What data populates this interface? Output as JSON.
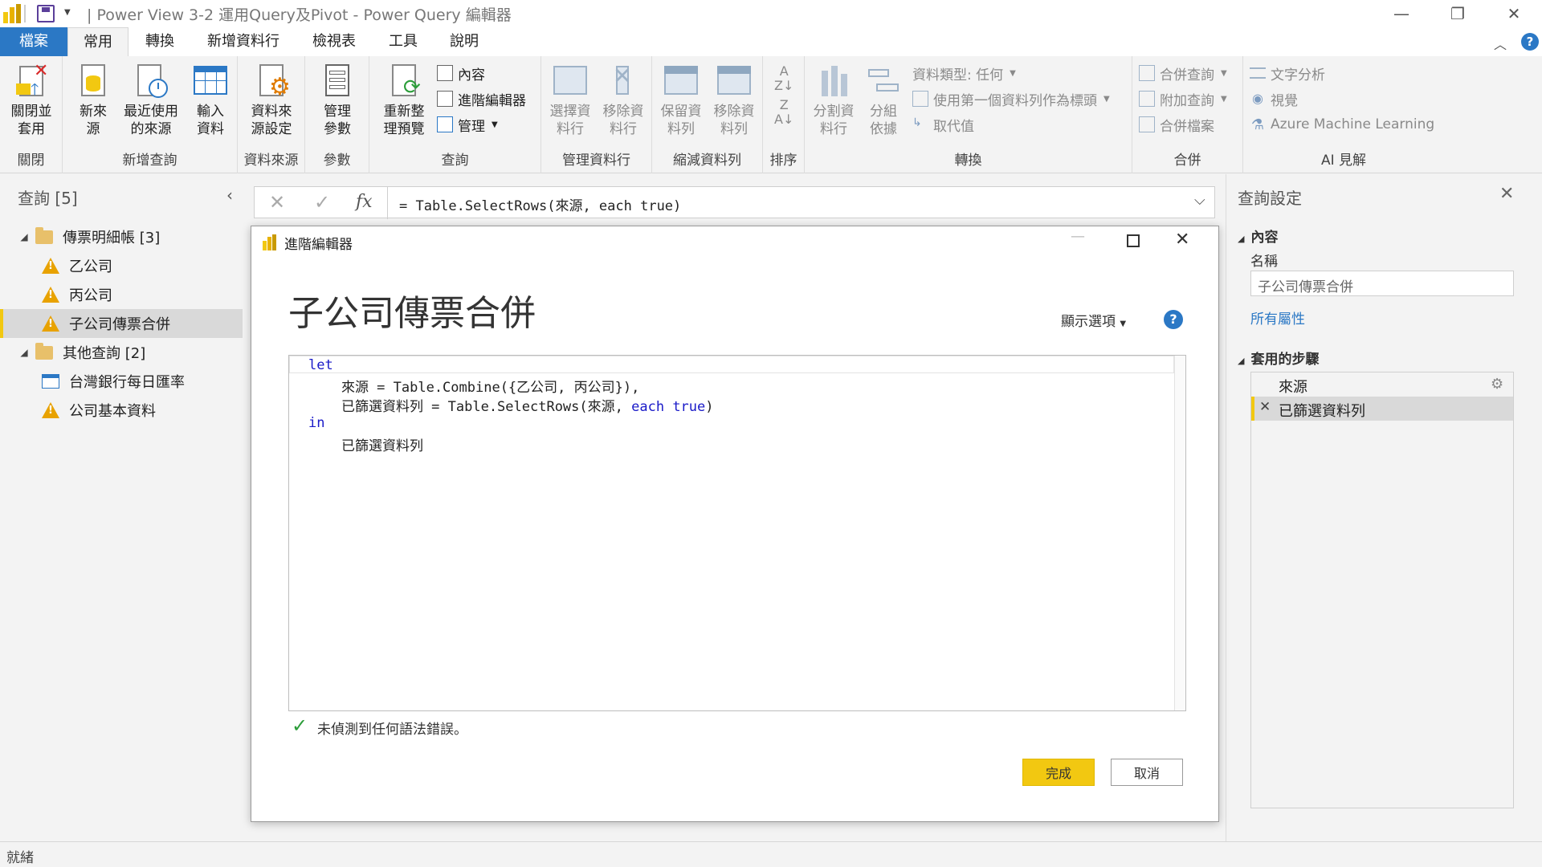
{
  "window": {
    "title": "| Power View 3-2 運用Query及Pivot - Power Query 編輯器"
  },
  "tabs": [
    "檔案",
    "常用",
    "轉換",
    "新增資料行",
    "檢視表",
    "工具",
    "說明"
  ],
  "ribbon": {
    "close": {
      "btn": "關閉並\n套用",
      "label": "關閉"
    },
    "newquery": {
      "new_source": "新來\n源",
      "recent": "最近使用\n的來源",
      "enter": "輸入\n資料",
      "label": "新增查詢"
    },
    "datasource": {
      "btn": "資料來\n源設定",
      "label": "資料來源"
    },
    "params": {
      "btn": "管理\n參數",
      "label": "參數"
    },
    "query": {
      "refresh": "重新整\n理預覽",
      "properties": "內容",
      "advanced": "進階編輯器",
      "manage": "管理",
      "label": "查詢"
    },
    "manage_cols": {
      "choose": "選擇資\n料行",
      "remove": "移除資\n料行",
      "label": "管理資料行"
    },
    "reduce": {
      "keep": "保留資\n料列",
      "remove": "移除資\n料列",
      "label": "縮減資料列"
    },
    "sort": {
      "label": "排序"
    },
    "transform": {
      "split": "分割資\n料行",
      "group": "分組\n依據",
      "datatype": "資料類型: 任何",
      "first_row": "使用第一個資料列作為標頭",
      "replace": "取代值",
      "label": "轉換"
    },
    "combine": {
      "merge": "合併查詢",
      "append": "附加查詢",
      "files": "合併檔案",
      "label": "合併"
    },
    "ai": {
      "text": "文字分析",
      "vision": "視覺",
      "azure": "Azure Machine Learning",
      "label": "AI 見解"
    }
  },
  "queries": {
    "header": "查詢 [5]",
    "groups": [
      {
        "name": "傳票明細帳 [3]",
        "items": [
          "乙公司",
          "丙公司",
          "子公司傳票合併"
        ]
      },
      {
        "name": "其他查詢 [2]",
        "items": [
          "台灣銀行每日匯率",
          "公司基本資料"
        ]
      }
    ]
  },
  "formula": {
    "fx": "fx",
    "text": "= Table.SelectRows(來源, each true)"
  },
  "settings": {
    "header": "查詢設定",
    "props_title": "內容",
    "name_label": "名稱",
    "name_value": "子公司傳票合併",
    "all_props": "所有屬性",
    "steps_title": "套用的步驟",
    "steps": [
      "來源",
      "已篩選資料列"
    ]
  },
  "dialog": {
    "title": "進階編輯器",
    "query_name": "子公司傳票合併",
    "options": "顯示選項",
    "status": "未偵測到任何語法錯誤。",
    "done": "完成",
    "cancel": "取消",
    "code": {
      "l1": "let",
      "l2a": "    來源 = Table.Combine({乙公司, 丙公司}),",
      "l3a": "    已篩選資料列 = Table.SelectRows(來源, ",
      "l3b": "each",
      "l3c": " ",
      "l3d": "true",
      "l3e": ")",
      "l4": "in",
      "l5": "    已篩選資料列"
    }
  },
  "status": {
    "text": "就緒"
  }
}
